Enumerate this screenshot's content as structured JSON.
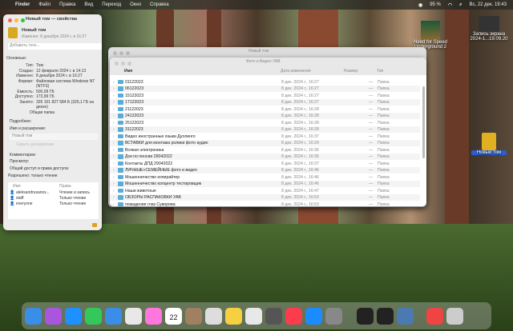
{
  "menubar": {
    "app": "Finder",
    "items": [
      "Файл",
      "Правка",
      "Вид",
      "Переход",
      "Окно",
      "Справка"
    ],
    "battery": "95 %",
    "datetime": "Вс, 22 дек.  19:43"
  },
  "desktop": {
    "icons": [
      {
        "label": "Need for Speed Underground 2"
      },
      {
        "label": "Запись экрана 2024-1...19.09.20"
      },
      {
        "label": "Новый том"
      }
    ]
  },
  "props": {
    "title": "Новый том — свойства",
    "name": "Новый том",
    "modified": "Изменен: 8 декабря 2024 г. в 16:27",
    "tags_placeholder": "Добавить теги...",
    "general": "Основные:",
    "fields": [
      [
        "Тип:",
        "Том"
      ],
      [
        "Создан:",
        "12 февраля 2024 г. в 14:13"
      ],
      [
        "Изменен:",
        "8 декабря 2024 г. в 16:27"
      ],
      [
        "Формат:",
        "Файловая система Windows NT (NTFS)"
      ],
      [
        "Емкость:",
        "500,09 ГБ"
      ],
      [
        "Доступно:",
        "173,99 ГБ"
      ],
      [
        "Занято:",
        "326 101 827 584 Б (326,1 ГБ на диске)"
      ]
    ],
    "shared": "Общая папка",
    "more": "Подробнее:",
    "name_ext": "Имя и расширение:",
    "name_value": "Новый том",
    "hide_ext": "Скрыть расширение",
    "comments": "Комментарии:",
    "preview": "Просмотр:",
    "sharing": "Общий доступ и права доступа:",
    "permission": "Разрешено: только чтение",
    "perm_headers": [
      "Имя",
      "Права"
    ],
    "perms": [
      [
        "aleksandrusanov...",
        "Чтение и запись"
      ],
      [
        "staff",
        "Только чтение"
      ],
      [
        "everyone",
        "Только чтение"
      ]
    ]
  },
  "back_window": {
    "title": "Новый том"
  },
  "finder": {
    "title": "Фото и Видео УАВ",
    "headers": [
      "Имя",
      "Дата изменения",
      "Размер",
      "Тип"
    ],
    "rows": [
      [
        "01122023",
        "8 дек. 2024 г., 16:27"
      ],
      [
        "06122023",
        "8 дек. 2024 г., 16:27"
      ],
      [
        "15122023",
        "8 дек. 2024 г., 16:27"
      ],
      [
        "17122023",
        "8 дек. 2024 г., 16:27"
      ],
      [
        "21122023",
        "8 дек. 2024 г., 16:28"
      ],
      [
        "24122023",
        "8 дек. 2024 г., 16:28"
      ],
      [
        "25122023",
        "8 дек. 2024 г., 16:28"
      ],
      [
        "31122023",
        "8 дек. 2024 г., 16:28"
      ],
      [
        "Видео иностранные языки Дуолинго",
        "8 дек. 2024 г., 16:37"
      ],
      [
        "ВСТАВКИ для монтажа ролики фото аудио",
        "8 дек. 2024 г., 16:29"
      ],
      [
        "Всякая электроника",
        "8 дек. 2024 г., 16:36"
      ],
      [
        "Док по пенсии 29042022",
        "8 дек. 2024 г., 16:36"
      ],
      [
        "Контакты ДПД 29042022",
        "8 дек. 2024 г., 16:37"
      ],
      [
        "ЛИЧНЫЕ+СЕМЕЙНЫЕ фото и видео",
        "8 дек. 2024 г., 16:46"
      ],
      [
        "Мошенничество копирайтер",
        "8 дек. 2024 г., 16:46"
      ],
      [
        "Мошенничество колцентр тестировщик",
        "8 дек. 2024 г., 16:46"
      ],
      [
        "Наши животные",
        "8 дек. 2024 г., 16:47"
      ],
      [
        "ОБЗОРЫ РАСПАКОВКИ УАВ",
        "8 дек. 2024 г., 16:53"
      ],
      [
        "пожадения глаз Суворова",
        "8 дек. 2024 г., 16:53"
      ]
    ],
    "size": "—",
    "type": "Папка"
  },
  "dock": {
    "calendar_day": "22",
    "calendar_month": "ДЕК."
  }
}
